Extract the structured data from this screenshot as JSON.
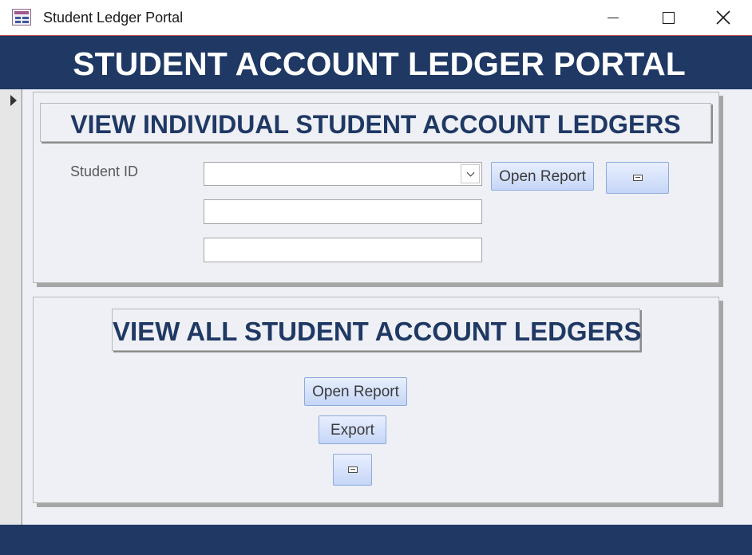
{
  "window": {
    "title": "Student Ledger Portal",
    "icon": "access-form-icon",
    "controls": [
      "minimize-icon",
      "maximize-icon",
      "close-icon"
    ]
  },
  "header": {
    "title": "STUDENT ACCOUNT LEDGER PORTAL",
    "background": "#1f3864"
  },
  "individual_section": {
    "heading": "VIEW INDIVIDUAL STUDENT ACCOUNT LEDGERS",
    "student_id_label": "Student ID",
    "student_id_value": "",
    "field_2_value": "",
    "field_3_value": "",
    "open_report_label": "Open Report",
    "email_icon": "email-icon"
  },
  "all_section": {
    "heading": "VIEW ALL STUDENT ACCOUNT LEDGERS",
    "open_report_label": "Open Report",
    "export_label": "Export",
    "email_icon": "email-icon"
  },
  "colors": {
    "brand": "#1f3864",
    "form_background": "#eef0f5",
    "button_fill": "#c6d6f7"
  }
}
